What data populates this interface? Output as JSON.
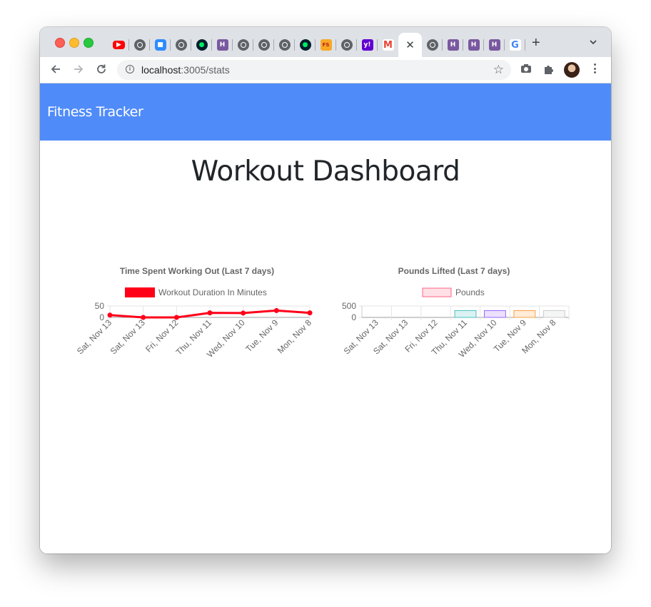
{
  "browser": {
    "url_host": "localhost",
    "url_path": ":3005/stats",
    "tabs": [
      {
        "icon": "youtube-icon"
      },
      {
        "icon": "globe-icon"
      },
      {
        "icon": "zoom-icon"
      },
      {
        "icon": "globe-icon"
      },
      {
        "icon": "mongodb-icon"
      },
      {
        "icon": "heroku-icon"
      },
      {
        "icon": "globe-icon"
      },
      {
        "icon": "globe-icon"
      },
      {
        "icon": "globe-icon"
      },
      {
        "icon": "mongodb-icon"
      },
      {
        "icon": "fs-icon"
      },
      {
        "icon": "globe-icon"
      },
      {
        "icon": "yahoo-icon"
      },
      {
        "icon": "gmail-icon"
      },
      {
        "icon": "close-icon",
        "active": true
      },
      {
        "icon": "globe-icon"
      },
      {
        "icon": "heroku-icon"
      },
      {
        "icon": "heroku-icon"
      },
      {
        "icon": "heroku-icon"
      },
      {
        "icon": "google-icon"
      }
    ]
  },
  "app": {
    "brand": "Fitness Tracker",
    "heading": "Workout Dashboard"
  },
  "chart_data": [
    {
      "type": "line",
      "title": "Time Spent Working Out (Last 7 days)",
      "categories": [
        "Sat, Nov 13",
        "Sat, Nov 13",
        "Fri, Nov 12",
        "Thu, Nov 11",
        "Wed, Nov 10",
        "Tue, Nov 9",
        "Mon, Nov 8"
      ],
      "series": [
        {
          "name": "Workout Duration In Minutes",
          "values": [
            10,
            0,
            0,
            20,
            19,
            30,
            20
          ],
          "color": "#ff0019"
        }
      ],
      "ylim": [
        0,
        50
      ],
      "yticks": [
        0,
        50
      ],
      "legend": "top"
    },
    {
      "type": "bar",
      "title": "Pounds Lifted (Last 7 days)",
      "categories": [
        "Sat, Nov 13",
        "Sat, Nov 13",
        "Fri, Nov 12",
        "Thu, Nov 11",
        "Wed, Nov 10",
        "Tue, Nov 9",
        "Mon, Nov 8"
      ],
      "series": [
        {
          "name": "Pounds",
          "values": [
            0,
            0,
            0,
            300,
            300,
            300,
            300
          ]
        }
      ],
      "bar_colors": [
        "#ff6384",
        "#ff6384",
        "#ff6384",
        "#4bc0c0",
        "#9966ff",
        "#ff9f40",
        "#c9cbcf"
      ],
      "legend_color": "#ff6384",
      "ylim": [
        0,
        500
      ],
      "yticks": [
        0,
        500
      ],
      "legend": "top"
    }
  ]
}
